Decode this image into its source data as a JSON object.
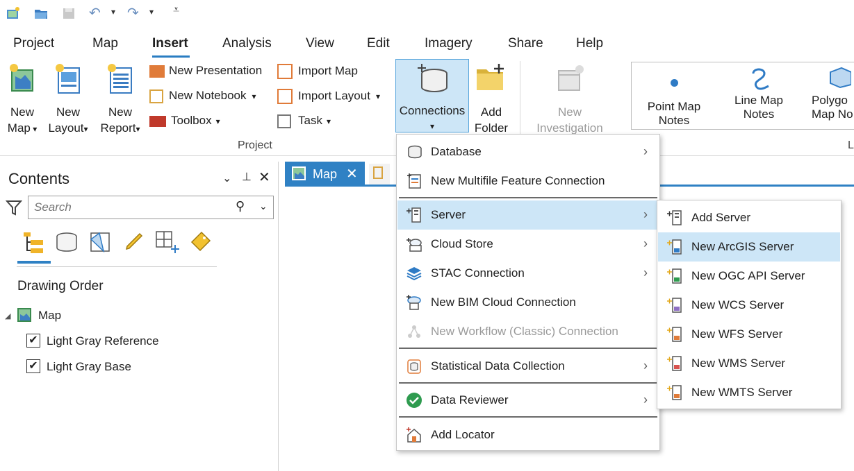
{
  "ribbon_tabs": [
    "Project",
    "Map",
    "Insert",
    "Analysis",
    "View",
    "Edit",
    "Imagery",
    "Share",
    "Help"
  ],
  "active_tab": "Insert",
  "project_group": {
    "label": "Project",
    "new_map": [
      "New",
      "Map"
    ],
    "new_layout": [
      "New",
      "Layout"
    ],
    "new_report": [
      "New",
      "Report"
    ],
    "new_presentation": "New Presentation",
    "new_notebook": "New Notebook",
    "toolbox": "Toolbox",
    "import_map": "Import Map",
    "import_layout": "Import Layout",
    "task": "Task",
    "connections": "Connections",
    "add_folder": [
      "Add",
      "Folder"
    ]
  },
  "investigation": [
    "New",
    "Investigation"
  ],
  "layer_templates": {
    "point": [
      "Point Map",
      "Notes"
    ],
    "line": [
      "Line Map",
      "Notes"
    ],
    "polygon": [
      "Polygo",
      "Map No"
    ],
    "group_initial": "L"
  },
  "contents_pane": {
    "title": "Contents",
    "search_placeholder": "Search",
    "section": "Drawing Order",
    "map_name": "Map",
    "layers": [
      "Light Gray Reference",
      "Light Gray Base"
    ]
  },
  "view_tab": "Map",
  "connections_menu": {
    "items": [
      {
        "label": "Database",
        "submenu": true
      },
      {
        "label": "New Multifile Feature Connection",
        "submenu": false
      },
      {
        "label": "Server",
        "submenu": true,
        "highlighted": true
      },
      {
        "label": "Cloud Store",
        "submenu": true
      },
      {
        "label": "STAC Connection",
        "submenu": true
      },
      {
        "label": "New BIM Cloud Connection",
        "submenu": false
      },
      {
        "label": "New Workflow (Classic) Connection",
        "submenu": false,
        "disabled": true
      },
      {
        "label": "Statistical Data Collection",
        "submenu": true
      },
      {
        "label": "Data Reviewer",
        "submenu": true
      },
      {
        "label": "Add Locator",
        "submenu": false
      }
    ]
  },
  "server_submenu": {
    "items": [
      {
        "label": "Add Server"
      },
      {
        "label": "New ArcGIS Server",
        "highlighted": true
      },
      {
        "label": "New OGC API Server"
      },
      {
        "label": "New WCS Server"
      },
      {
        "label": "New WFS Server"
      },
      {
        "label": "New WMS Server"
      },
      {
        "label": "New WMTS Server"
      }
    ]
  },
  "colors": {
    "accent": "#2f81c4",
    "highlight": "#cde6f7",
    "check": "#2e9b4f"
  }
}
